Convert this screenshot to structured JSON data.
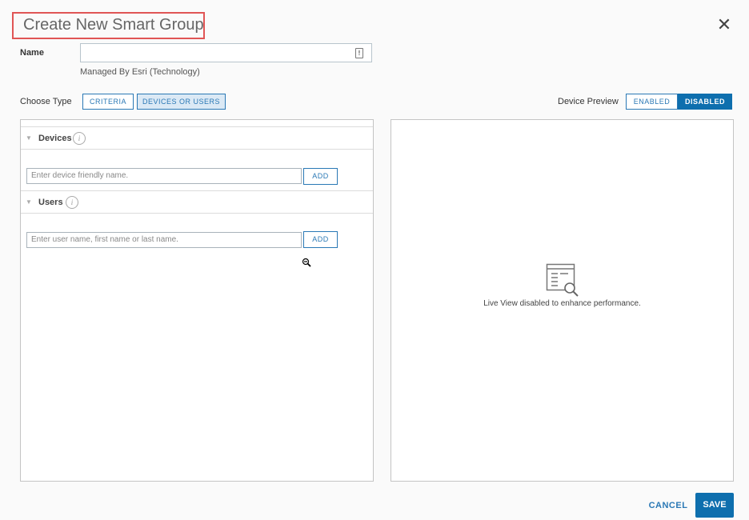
{
  "dialog": {
    "title": "Create New Smart Group",
    "close_icon": "close-icon"
  },
  "name_field": {
    "label": "Name",
    "value": "",
    "managed_by": "Managed By Esri (Technology)"
  },
  "choose_type": {
    "label": "Choose Type",
    "options": [
      "CRITERIA",
      "DEVICES OR USERS"
    ],
    "selected": "DEVICES OR USERS"
  },
  "device_preview": {
    "label": "Device Preview",
    "enabled_label": "ENABLED",
    "disabled_label": "DISABLED",
    "selected": "DISABLED",
    "message": "Live View disabled to enhance performance."
  },
  "devices": {
    "header": "Devices",
    "placeholder": "Enter device friendly name.",
    "add_label": "ADD"
  },
  "users": {
    "header": "Users",
    "placeholder": "Enter user name, first name or last name.",
    "add_label": "ADD"
  },
  "footer": {
    "cancel_label": "CANCEL",
    "save_label": "SAVE"
  },
  "colors": {
    "accent": "#0e6fae",
    "title_highlight": "#e05555"
  }
}
